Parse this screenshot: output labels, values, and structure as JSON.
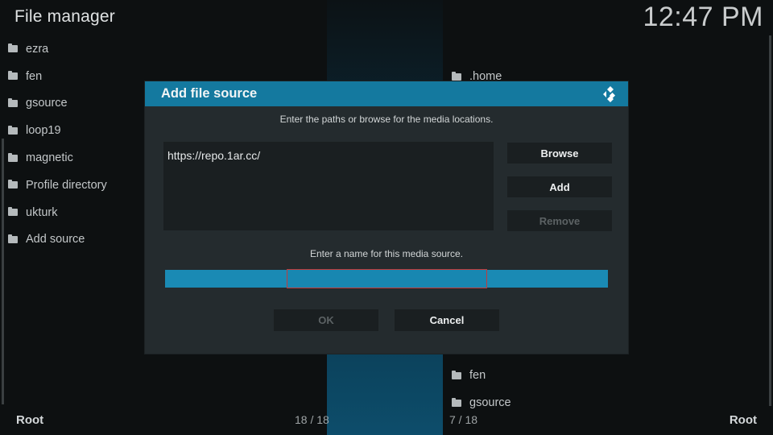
{
  "app": {
    "title": "File manager",
    "clock": "12:47 PM"
  },
  "left_list": {
    "items": [
      {
        "label": "ezra"
      },
      {
        "label": "fen"
      },
      {
        "label": "gsource"
      },
      {
        "label": "loop19"
      },
      {
        "label": "magnetic"
      },
      {
        "label": "Profile directory"
      },
      {
        "label": "ukturk"
      },
      {
        "label": "Add source"
      }
    ]
  },
  "right_list": {
    "items": [
      {
        "label": ".home"
      },
      {
        "label": "fen"
      },
      {
        "label": "gsource"
      }
    ]
  },
  "footer": {
    "left_path": "Root",
    "left_count": "18 / 18",
    "right_count": "7 / 18",
    "right_path": "Root"
  },
  "dialog": {
    "title": "Add file source",
    "paths_instruction": "Enter the paths or browse for the media locations.",
    "path_value": "https://repo.1ar.cc/",
    "browse_label": "Browse",
    "add_label": "Add",
    "remove_label": "Remove",
    "name_instruction": "Enter a name for this media source.",
    "name_value": "",
    "ok_label": "OK",
    "cancel_label": "Cancel"
  },
  "colors": {
    "accent": "#14799f",
    "name_field": "#1a8ab4",
    "focus_outline": "#c23b3b",
    "background": "#0b0d0e"
  },
  "icons": {
    "folder": "folder-icon",
    "logo": "kodi-logo-icon"
  }
}
